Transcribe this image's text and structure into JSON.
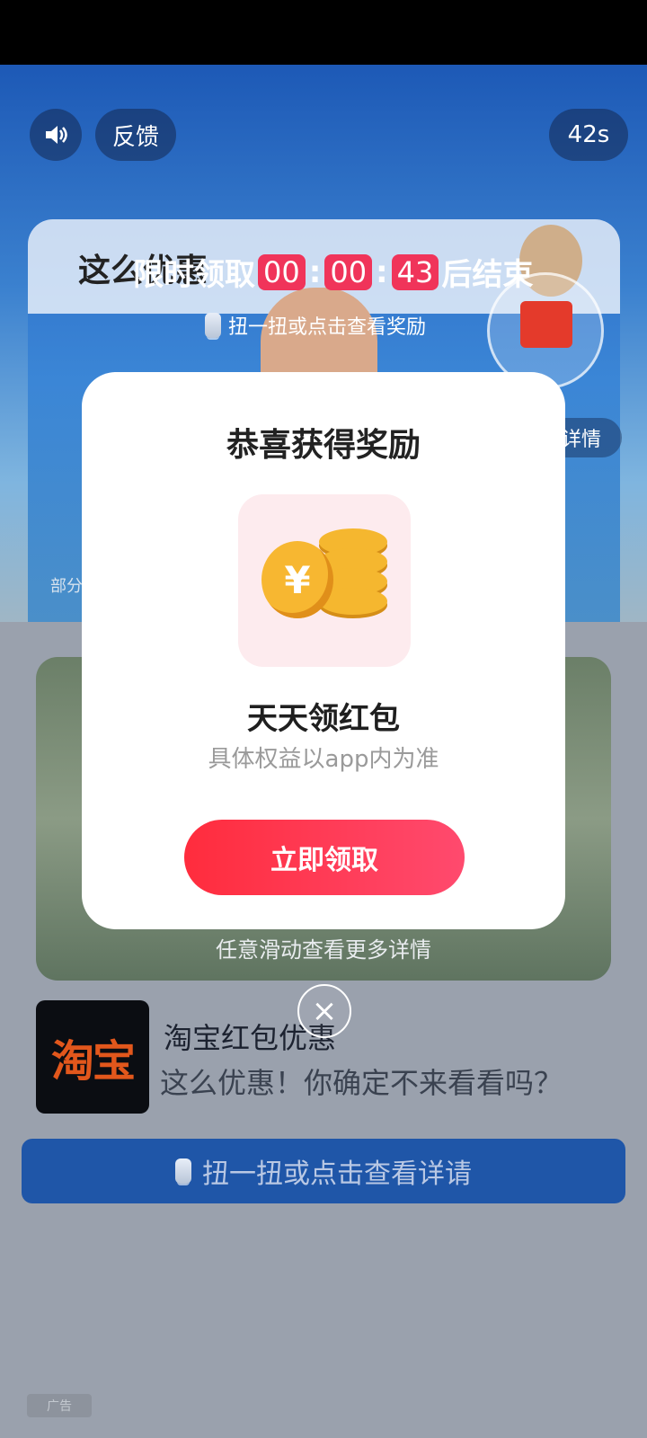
{
  "top_controls": {
    "feedback_label": "反馈",
    "timer": "42s"
  },
  "video": {
    "title": "这么优惠",
    "countdown_prefix": "限时领取",
    "countdown_hours": "00",
    "countdown_minutes": "00",
    "countdown_seconds": "43",
    "countdown_suffix": "后结束",
    "shake_hint": "扭一扭或点击查看奖励",
    "detail_chip": "详情",
    "partial_text": "部分"
  },
  "swipe_hint": "任意滑动查看更多详情",
  "app": {
    "icon_text": "淘宝",
    "name": "淘宝红包优惠",
    "description": "这么优惠！你确定不来看看吗？"
  },
  "cta": {
    "label": "扭一扭或点击查看详请"
  },
  "ad_badge": "广告",
  "modal": {
    "title": "恭喜获得奖励",
    "reward_name": "天天领红包",
    "reward_note": "具体权益以app内为准",
    "claim_button": "立即领取"
  }
}
